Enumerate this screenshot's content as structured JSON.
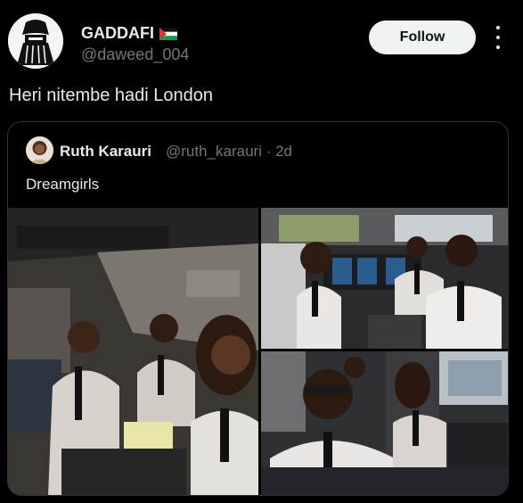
{
  "tweet": {
    "display_name": "GADDAFI",
    "handle": "@daweed_004",
    "follow_label": "Follow",
    "text": "Heri nitembe hadi London",
    "avatar_icon": "desert-rider-avatar",
    "flag_icon": "palestine-flag-icon"
  },
  "quote": {
    "display_name": "Ruth Karauri",
    "handle_time": "@ruth_karauri · 2d",
    "text": "Dreamgirls"
  },
  "media": [
    {
      "description_icon": "cockpit-photo"
    },
    {
      "description_icon": "cockpit-photo"
    },
    {
      "description_icon": "cockpit-photo"
    }
  ],
  "colors": {
    "background": "#000000",
    "primary_text": "#e7e9ea",
    "secondary_text": "#71767b",
    "follow_bg": "#eff3f4",
    "border": "#2f3336"
  }
}
